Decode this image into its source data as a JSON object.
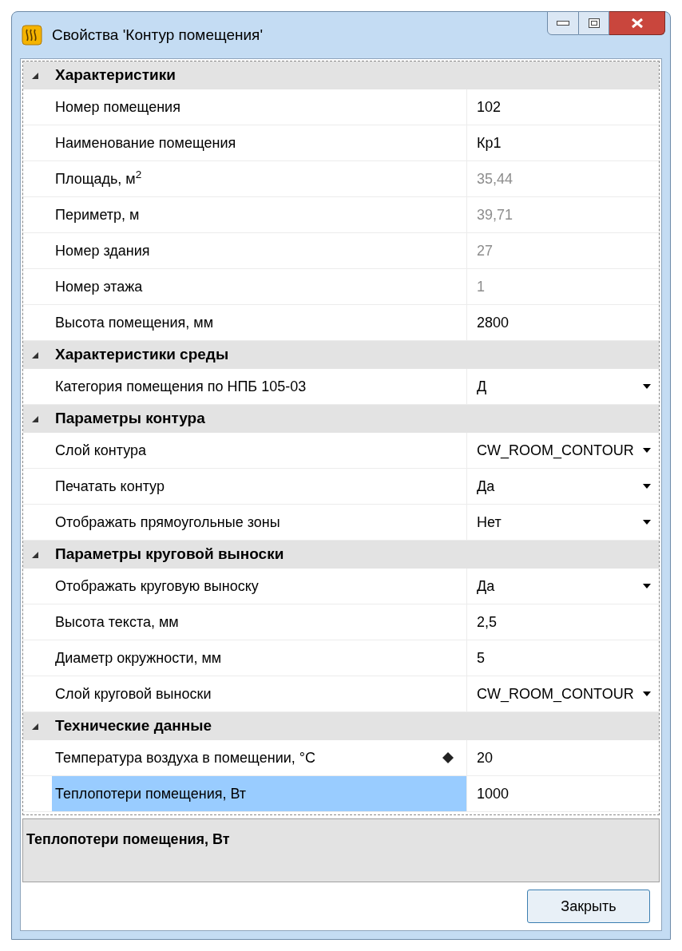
{
  "window": {
    "title": "Свойства 'Контур помещения'"
  },
  "categories": [
    {
      "name": "Характеристики",
      "expanded": true,
      "properties": [
        {
          "label": "Номер помещения",
          "value": "102",
          "kind": "text",
          "disabled": false,
          "selected": false,
          "indicator": false
        },
        {
          "label": "Наименование помещения",
          "value": "Кр1",
          "kind": "text",
          "disabled": false,
          "selected": false,
          "indicator": false
        },
        {
          "label": "Площадь, м$^{2}$",
          "value": "35,44",
          "kind": "text",
          "disabled": true,
          "selected": false,
          "indicator": false
        },
        {
          "label": "Периметр, м",
          "value": "39,71",
          "kind": "text",
          "disabled": true,
          "selected": false,
          "indicator": false
        },
        {
          "label": "Номер здания",
          "value": "27",
          "kind": "text",
          "disabled": true,
          "selected": false,
          "indicator": false
        },
        {
          "label": "Номер этажа",
          "value": "1",
          "kind": "text",
          "disabled": true,
          "selected": false,
          "indicator": false
        },
        {
          "label": "Высота помещения, мм",
          "value": "2800",
          "kind": "text",
          "disabled": false,
          "selected": false,
          "indicator": false
        }
      ]
    },
    {
      "name": "Характеристики среды",
      "expanded": true,
      "properties": [
        {
          "label": "Категория помещения по НПБ 105-03",
          "value": "Д",
          "kind": "dropdown",
          "disabled": false,
          "selected": false,
          "indicator": false
        }
      ]
    },
    {
      "name": "Параметры контура",
      "expanded": true,
      "properties": [
        {
          "label": "Слой контура",
          "value": "CW_ROOM_CONTOUR",
          "kind": "dropdown",
          "disabled": false,
          "selected": false,
          "indicator": false
        },
        {
          "label": "Печатать контур",
          "value": "Да",
          "kind": "dropdown",
          "disabled": false,
          "selected": false,
          "indicator": false
        },
        {
          "label": "Отображать прямоугольные зоны",
          "value": "Нет",
          "kind": "dropdown",
          "disabled": false,
          "selected": false,
          "indicator": false
        }
      ]
    },
    {
      "name": "Параметры круговой выноски",
      "expanded": true,
      "properties": [
        {
          "label": "Отображать круговую выноску",
          "value": "Да",
          "kind": "dropdown",
          "disabled": false,
          "selected": false,
          "indicator": false
        },
        {
          "label": "Высота текста, мм",
          "value": "2,5",
          "kind": "text",
          "disabled": false,
          "selected": false,
          "indicator": false
        },
        {
          "label": "Диаметр окружности, мм",
          "value": "5",
          "kind": "text",
          "disabled": false,
          "selected": false,
          "indicator": false
        },
        {
          "label": "Слой круговой выноски",
          "value": "CW_ROOM_CONTOUR",
          "kind": "dropdown",
          "disabled": false,
          "selected": false,
          "indicator": false
        }
      ]
    },
    {
      "name": "Технические данные",
      "expanded": true,
      "properties": [
        {
          "label": "Температура воздуха в помещении, °С",
          "value": "20",
          "kind": "text",
          "disabled": false,
          "selected": false,
          "indicator": true
        },
        {
          "label": "Теплопотери помещения, Вт",
          "value": "1000",
          "kind": "text",
          "disabled": false,
          "selected": true,
          "indicator": false
        }
      ]
    }
  ],
  "description": {
    "title": "Теплопотери помещения, Вт"
  },
  "buttons": [
    {
      "label": "Закрыть"
    }
  ]
}
